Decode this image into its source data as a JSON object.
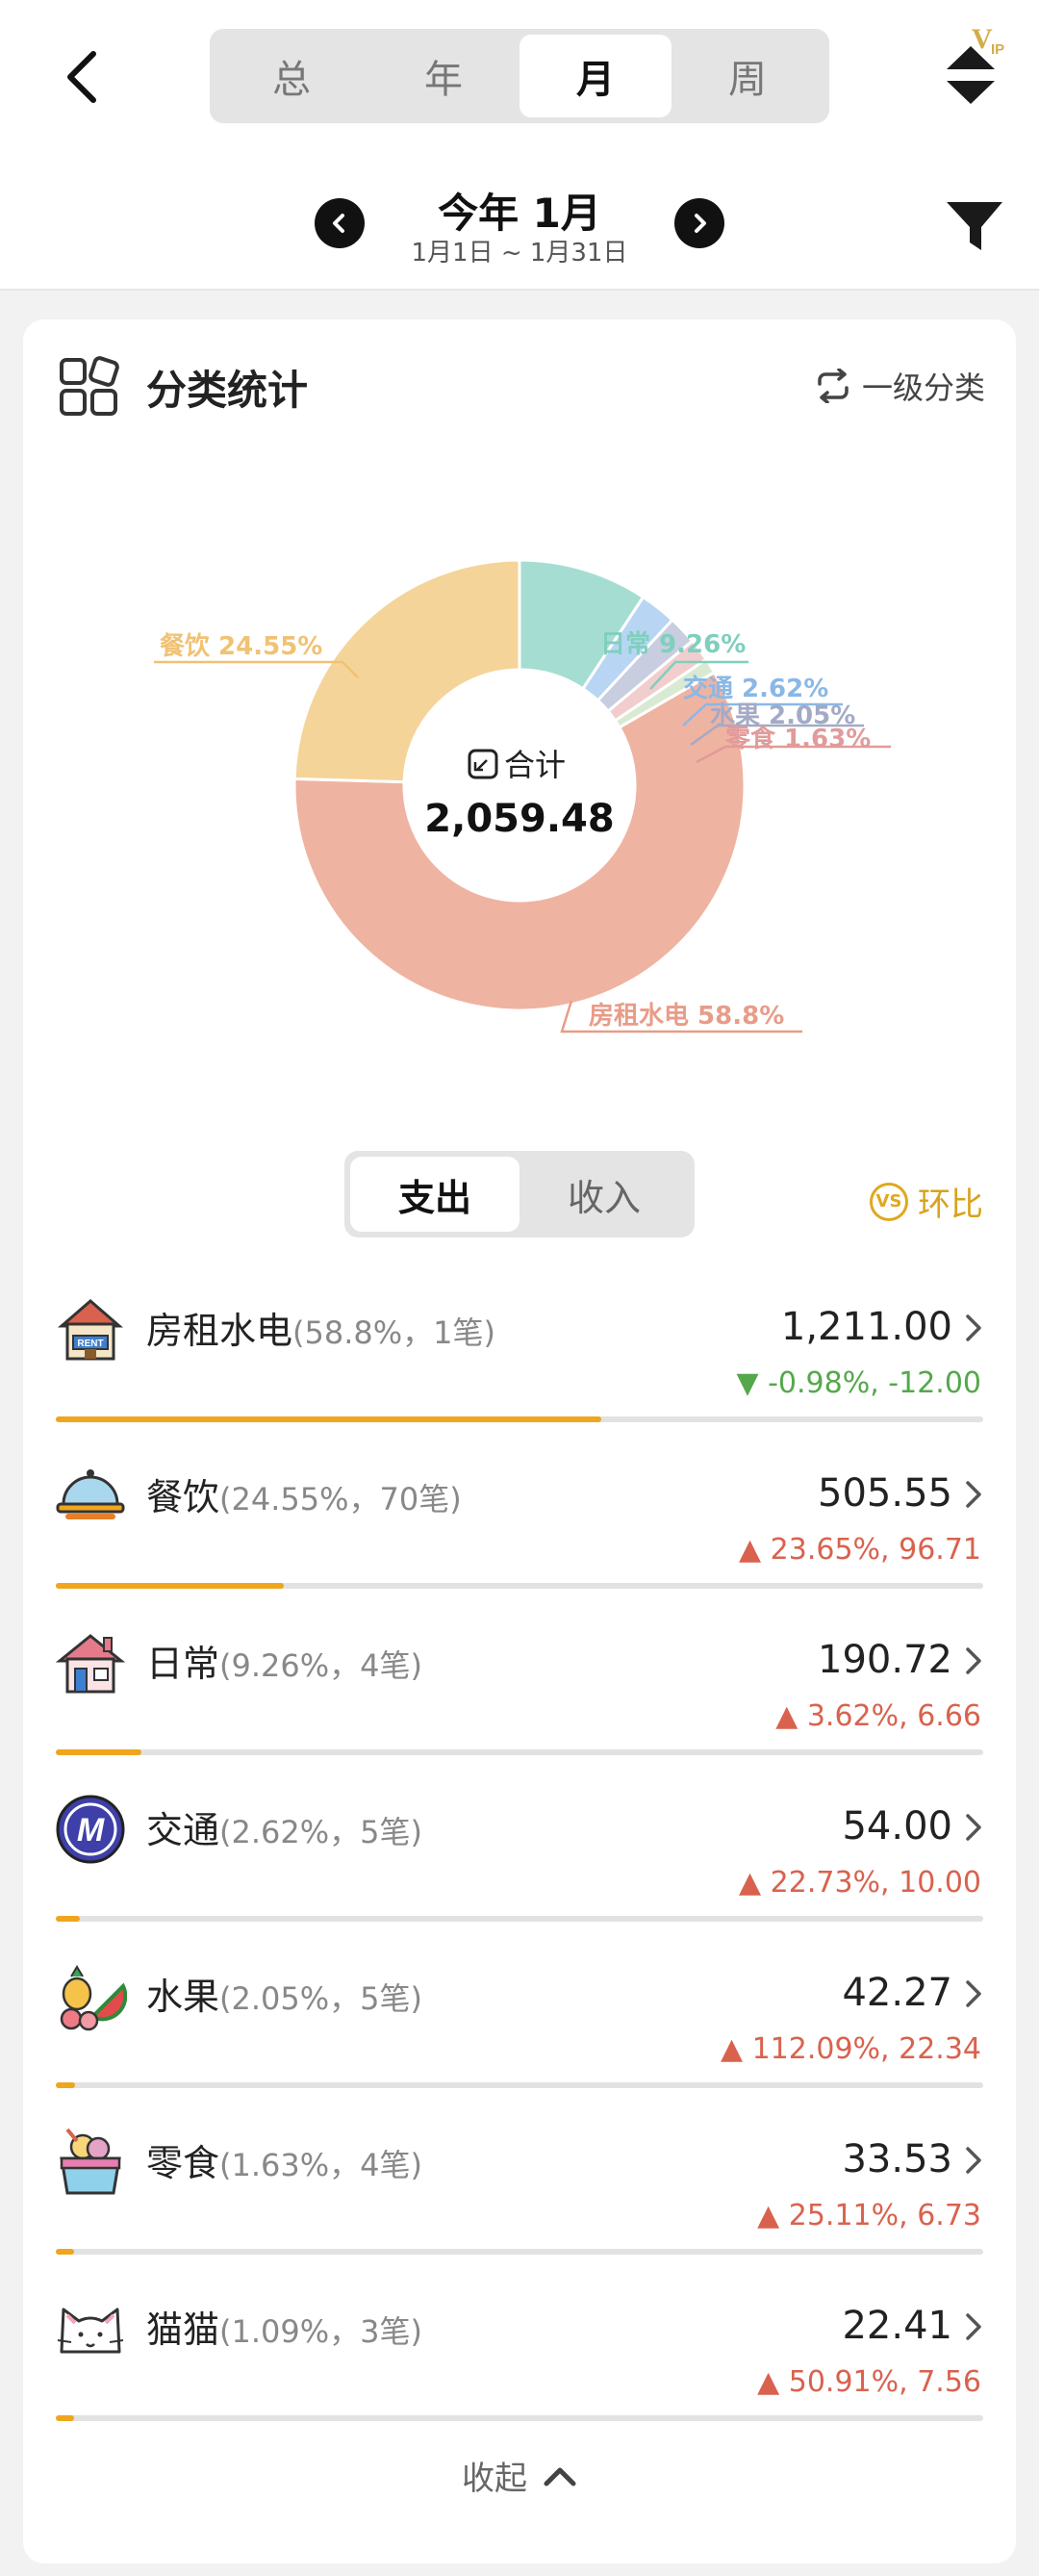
{
  "header": {
    "period_tabs": [
      "总",
      "年",
      "月",
      "周"
    ],
    "active_period": "月",
    "vip_label": "VIP",
    "date_title": "今年 1月",
    "date_range": "1月1日 ~ 1月31日"
  },
  "card": {
    "title": "分类统计",
    "level_switch_label": "一级分类",
    "total_label": "合计",
    "total_value": "2,059.48",
    "io_tabs": [
      "支出",
      "收入"
    ],
    "active_io": "支出",
    "mom_label": "环比",
    "mom_badge": "VS",
    "collapse_label": "收起"
  },
  "chart_data": {
    "type": "pie",
    "donut": true,
    "slices": [
      {
        "label": "日常",
        "percent": 9.26,
        "display": "日常 9.26%",
        "color": "#a6ddd2",
        "label_color": "#7fcfbe"
      },
      {
        "label": "交通",
        "percent": 2.62,
        "display": "交通 2.62%",
        "color": "#b8d6f3",
        "label_color": "#8ab8e6"
      },
      {
        "label": "水果",
        "percent": 2.05,
        "display": "水果 2.05%",
        "color": "#c8cde0",
        "label_color": "#a3aac6"
      },
      {
        "label": "零食",
        "percent": 1.63,
        "display": "零食 1.63%",
        "color": "#f1cdcd",
        "label_color": "#e29a9a"
      },
      {
        "label": "猫猫",
        "percent": 1.09,
        "display": "",
        "color": "#d9ead2",
        "label_color": "#b5cfaa"
      },
      {
        "label": "房租水电",
        "percent": 58.8,
        "display": "房租水电 58.8%",
        "color": "#efb3a2",
        "label_color": "#e89c88"
      },
      {
        "label": "餐饮",
        "percent": 24.55,
        "display": "餐饮 24.55%",
        "color": "#f5d49a",
        "label_color": "#f0c274"
      }
    ]
  },
  "categories": [
    {
      "name": "房租水电",
      "meta": "(58.8%，1笔)",
      "amount": "1,211.00",
      "change": "-0.98%, -12.00",
      "direction": "down",
      "share": 0.588,
      "icon": "house-rent-icon"
    },
    {
      "name": "餐饮",
      "meta": "(24.55%，70笔)",
      "amount": "505.55",
      "change": "23.65%, 96.71",
      "direction": "up",
      "share": 0.2455,
      "icon": "food-cloche-icon"
    },
    {
      "name": "日常",
      "meta": "(9.26%，4笔)",
      "amount": "190.72",
      "change": "3.62%, 6.66",
      "direction": "up",
      "share": 0.0926,
      "icon": "home-icon"
    },
    {
      "name": "交通",
      "meta": "(2.62%，5笔)",
      "amount": "54.00",
      "change": "22.73%, 10.00",
      "direction": "up",
      "share": 0.0262,
      "icon": "metro-icon"
    },
    {
      "name": "水果",
      "meta": "(2.05%，5笔)",
      "amount": "42.27",
      "change": "112.09%, 22.34",
      "direction": "up",
      "share": 0.0205,
      "icon": "fruit-icon"
    },
    {
      "name": "零食",
      "meta": "(1.63%，4笔)",
      "amount": "33.53",
      "change": "25.11%, 6.73",
      "direction": "up",
      "share": 0.0163,
      "icon": "snack-icon"
    },
    {
      "name": "猫猫",
      "meta": "(1.09%，3笔)",
      "amount": "22.41",
      "change": "50.91%, 7.56",
      "direction": "up",
      "share": 0.0109,
      "icon": "cat-icon"
    }
  ]
}
